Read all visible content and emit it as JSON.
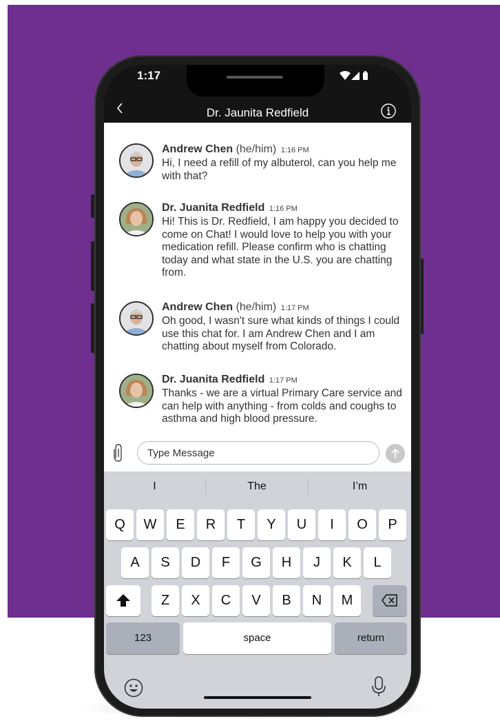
{
  "status_bar": {
    "time": "1:17"
  },
  "header": {
    "back_icon": "chevron-left-icon",
    "title": "Dr. Jaunita Redfield",
    "info_icon": "info-icon"
  },
  "messages": [
    {
      "sender": "Andrew Chen",
      "pronouns": " (he/him)",
      "time": "1:16 PM",
      "text": "Hi, I need a refill of my albuterol, can you help me with that?"
    },
    {
      "sender": "Dr. Juanita Redfield",
      "pronouns": "",
      "time": "1:16 PM",
      "text": "Hi! This is Dr. Redfield, I am happy you decided to come on Chat! I would love to help you with your medication refill. Please confirm who is chatting today and what state in the U.S. you are chatting from."
    },
    {
      "sender": "Andrew Chen",
      "pronouns": " (he/him)",
      "time": "1:17 PM",
      "text": "Oh good, I wasn't sure what kinds of things I could use this chat for. I am Andrew Chen and I am chatting about myself from Colorado."
    },
    {
      "sender": "Dr. Juanita Redfield",
      "pronouns": "",
      "time": "1:17 PM",
      "text": "Thanks - we are a virtual Primary Care service and can help with anything - from colds and coughs to asthma and high blood pressure."
    }
  ],
  "input": {
    "placeholder": "Type Message"
  },
  "keyboard": {
    "suggestions": [
      "I",
      "The",
      "I’m"
    ],
    "row1": [
      "Q",
      "W",
      "E",
      "R",
      "T",
      "Y",
      "U",
      "I",
      "O",
      "P"
    ],
    "row2": [
      "A",
      "S",
      "D",
      "F",
      "G",
      "H",
      "J",
      "K",
      "L"
    ],
    "row3": [
      "Z",
      "X",
      "C",
      "V",
      "B",
      "N",
      "M"
    ],
    "numbers_label": "123",
    "space_label": "space",
    "return_label": "return"
  },
  "colors": {
    "background_panel": "#6e2f8e",
    "header": "#141414",
    "keyboard": "#d1d3d9"
  }
}
